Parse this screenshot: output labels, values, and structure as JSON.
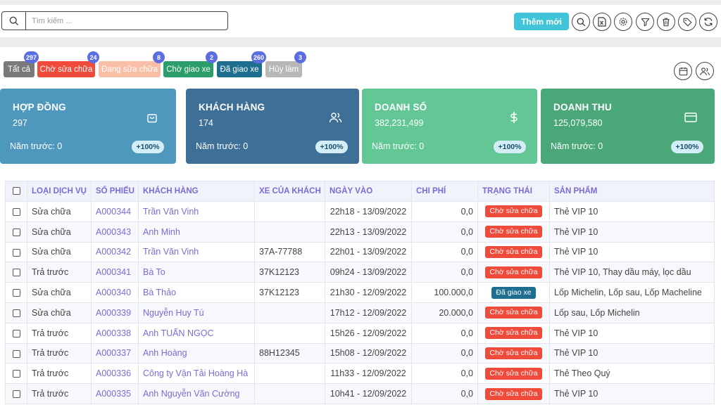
{
  "search": {
    "placeholder": "Tìm kiếm ...",
    "value": ""
  },
  "toolbar": {
    "add_label": "Thêm mới",
    "tools": [
      "search-icon",
      "excel-file-icon",
      "settings-icon",
      "filter-icon",
      "trash-icon",
      "tag-icon",
      "refresh-icon"
    ]
  },
  "filters": [
    {
      "label": "Tất cả",
      "count": "297",
      "color": "#7a7a7a"
    },
    {
      "label": "Chờ sửa chữa",
      "count": "24",
      "color": "#ef4a3a"
    },
    {
      "label": "Đang sửa chữa",
      "count": "8",
      "color": "#f8bfa6"
    },
    {
      "label": "Chờ giao xe",
      "count": "2",
      "color": "#2a9d6a"
    },
    {
      "label": "Đã giao xe",
      "count": "260",
      "color": "#1e6f8f"
    },
    {
      "label": "Hủy làm",
      "count": "3",
      "color": "#b8b8b8"
    }
  ],
  "cards": [
    {
      "title": "HỢP ĐỒNG",
      "value": "297",
      "prev": "Năm trước: 0",
      "pct": "+100%",
      "icon": "shopping-bag-icon",
      "color": "#4f98bd"
    },
    {
      "title": "KHÁCH HÀNG",
      "value": "174",
      "prev": "Năm trước: 0",
      "pct": "+100%",
      "icon": "users-icon",
      "color": "#3e6f96"
    },
    {
      "title": "DOANH SỐ",
      "value": "382,231,499",
      "prev": "Năm trước: 0",
      "pct": "+100%",
      "icon": "dollar-icon",
      "color": "#62c795"
    },
    {
      "title": "DOANH THU",
      "value": "125,079,580",
      "prev": "Năm trước: 0",
      "pct": "+100%",
      "icon": "credit-card-icon",
      "color": "#4aa878"
    }
  ],
  "table": {
    "headers": [
      "LOẠI DỊCH VỤ",
      "SỐ PHIẾU",
      "KHÁCH HÀNG",
      "XE CỦA KHÁCH",
      "NGÀY VÀO",
      "CHI PHÍ",
      "TRẠNG THÁI",
      "SẢN PHẨM"
    ],
    "rows": [
      {
        "type": "Sửa chữa",
        "code": "A000344",
        "customer": "Trần Văn Vinh",
        "vehicle": "",
        "date": "22h18 - 13/09/2022",
        "cost": "0,0",
        "status": "Chờ sửa chữa",
        "product": "Thẻ VIP 10"
      },
      {
        "type": "Sửa chữa",
        "code": "A000343",
        "customer": "Anh Minh",
        "vehicle": "",
        "date": "22h13 - 13/09/2022",
        "cost": "0,0",
        "status": "Chờ sửa chữa",
        "product": "Thẻ VIP 10"
      },
      {
        "type": "Sửa chữa",
        "code": "A000342",
        "customer": "Trần Văn Vinh",
        "vehicle": "37A-77788",
        "date": "22h01 - 13/09/2022",
        "cost": "0,0",
        "status": "Chờ sửa chữa",
        "product": "Thẻ VIP 10"
      },
      {
        "type": "Trả trước",
        "code": "A000341",
        "customer": "Bà To",
        "vehicle": "37K12123",
        "date": "09h24 - 13/09/2022",
        "cost": "0,0",
        "status": "Chờ sửa chữa",
        "product": "Thẻ VIP 10, Thay dầu máy, lọc dầu"
      },
      {
        "type": "Sửa chữa",
        "code": "A000340",
        "customer": "Bà Thảo",
        "vehicle": "37K12123",
        "date": "21h30 - 12/09/2022",
        "cost": "100.000,0",
        "status": "Đã giao xe",
        "product": "Lốp Michelin, Lốp sau, Lốp Macheline"
      },
      {
        "type": "Sửa chữa",
        "code": "A000339",
        "customer": "Nguyễn Huy Tú",
        "vehicle": "",
        "date": "17h12 - 12/09/2022",
        "cost": "20.000,0",
        "status": "Chờ sửa chữa",
        "product": "Lốp sau, Lốp Michelin"
      },
      {
        "type": "Trả trước",
        "code": "A000338",
        "customer": "Anh TUẤN NGỌC",
        "vehicle": "",
        "date": "15h26 - 12/09/2022",
        "cost": "0,0",
        "status": "Chờ sửa chữa",
        "product": "Thẻ VIP 10"
      },
      {
        "type": "Trả trước",
        "code": "A000337",
        "customer": "Anh Hoàng",
        "vehicle": "88H12345",
        "date": "15h08 - 12/09/2022",
        "cost": "0,0",
        "status": "Chờ sửa chữa",
        "product": "Thẻ VIP 10"
      },
      {
        "type": "Trả trước",
        "code": "A000336",
        "customer": "Công ty Vận Tải Hoàng Hà",
        "vehicle": "",
        "date": "11h33 - 12/09/2022",
        "cost": "0,0",
        "status": "Chờ sửa chữa",
        "product": "Thẻ Theo Quý"
      },
      {
        "type": "Trả trước",
        "code": "A000335",
        "customer": "Anh Nguyễn Văn Cường",
        "vehicle": "",
        "date": "10h41 - 12/09/2022",
        "cost": "0,0",
        "status": "Chờ sửa chữa",
        "product": "Thẻ VIP 10"
      }
    ]
  },
  "status_colors": {
    "Chờ sửa chữa": "#ef4a3a",
    "Đã giao xe": "#1e6f8f"
  }
}
